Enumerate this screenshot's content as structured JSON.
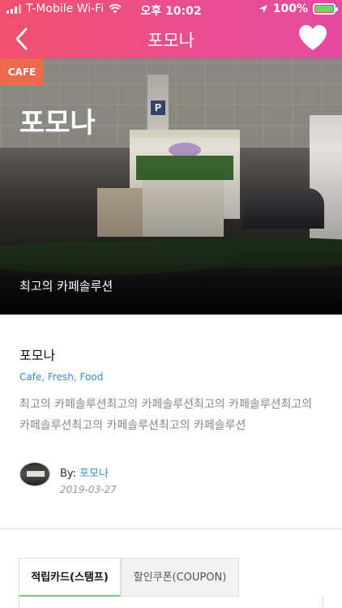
{
  "status_bar": {
    "carrier": "T-Mobile Wi-Fi",
    "time": "오후 10:02",
    "battery": "100%"
  },
  "header": {
    "title": "포모나",
    "icons": {
      "back": "chevron-left-icon",
      "favorite": "heart-icon"
    }
  },
  "hero": {
    "badge": "CAFE",
    "title": "포모나",
    "subtitle": "최고의 카페솔루션"
  },
  "info": {
    "name": "포모나",
    "tags": "Cafe, Fresh, Food",
    "description": "최고의 카페솔루션최고의 카페솔루션최고의 카페솔루션최고의 카페솔루션최고의 카페솔루션최고의 카페솔루션",
    "author_prefix": "By:",
    "author_name": "포모나",
    "date": "2019-03-27"
  },
  "tabs": [
    {
      "label": "적립카드(스탬프)",
      "active": true
    },
    {
      "label": "할인쿠폰(COUPON)",
      "active": false
    }
  ],
  "colors": {
    "header_gradient_start": "#f0506c",
    "header_gradient_end": "#e64aa0",
    "badge": "#ee6a4f",
    "link": "#3b8bd0",
    "active_tab_underline": "#7dc77c"
  }
}
